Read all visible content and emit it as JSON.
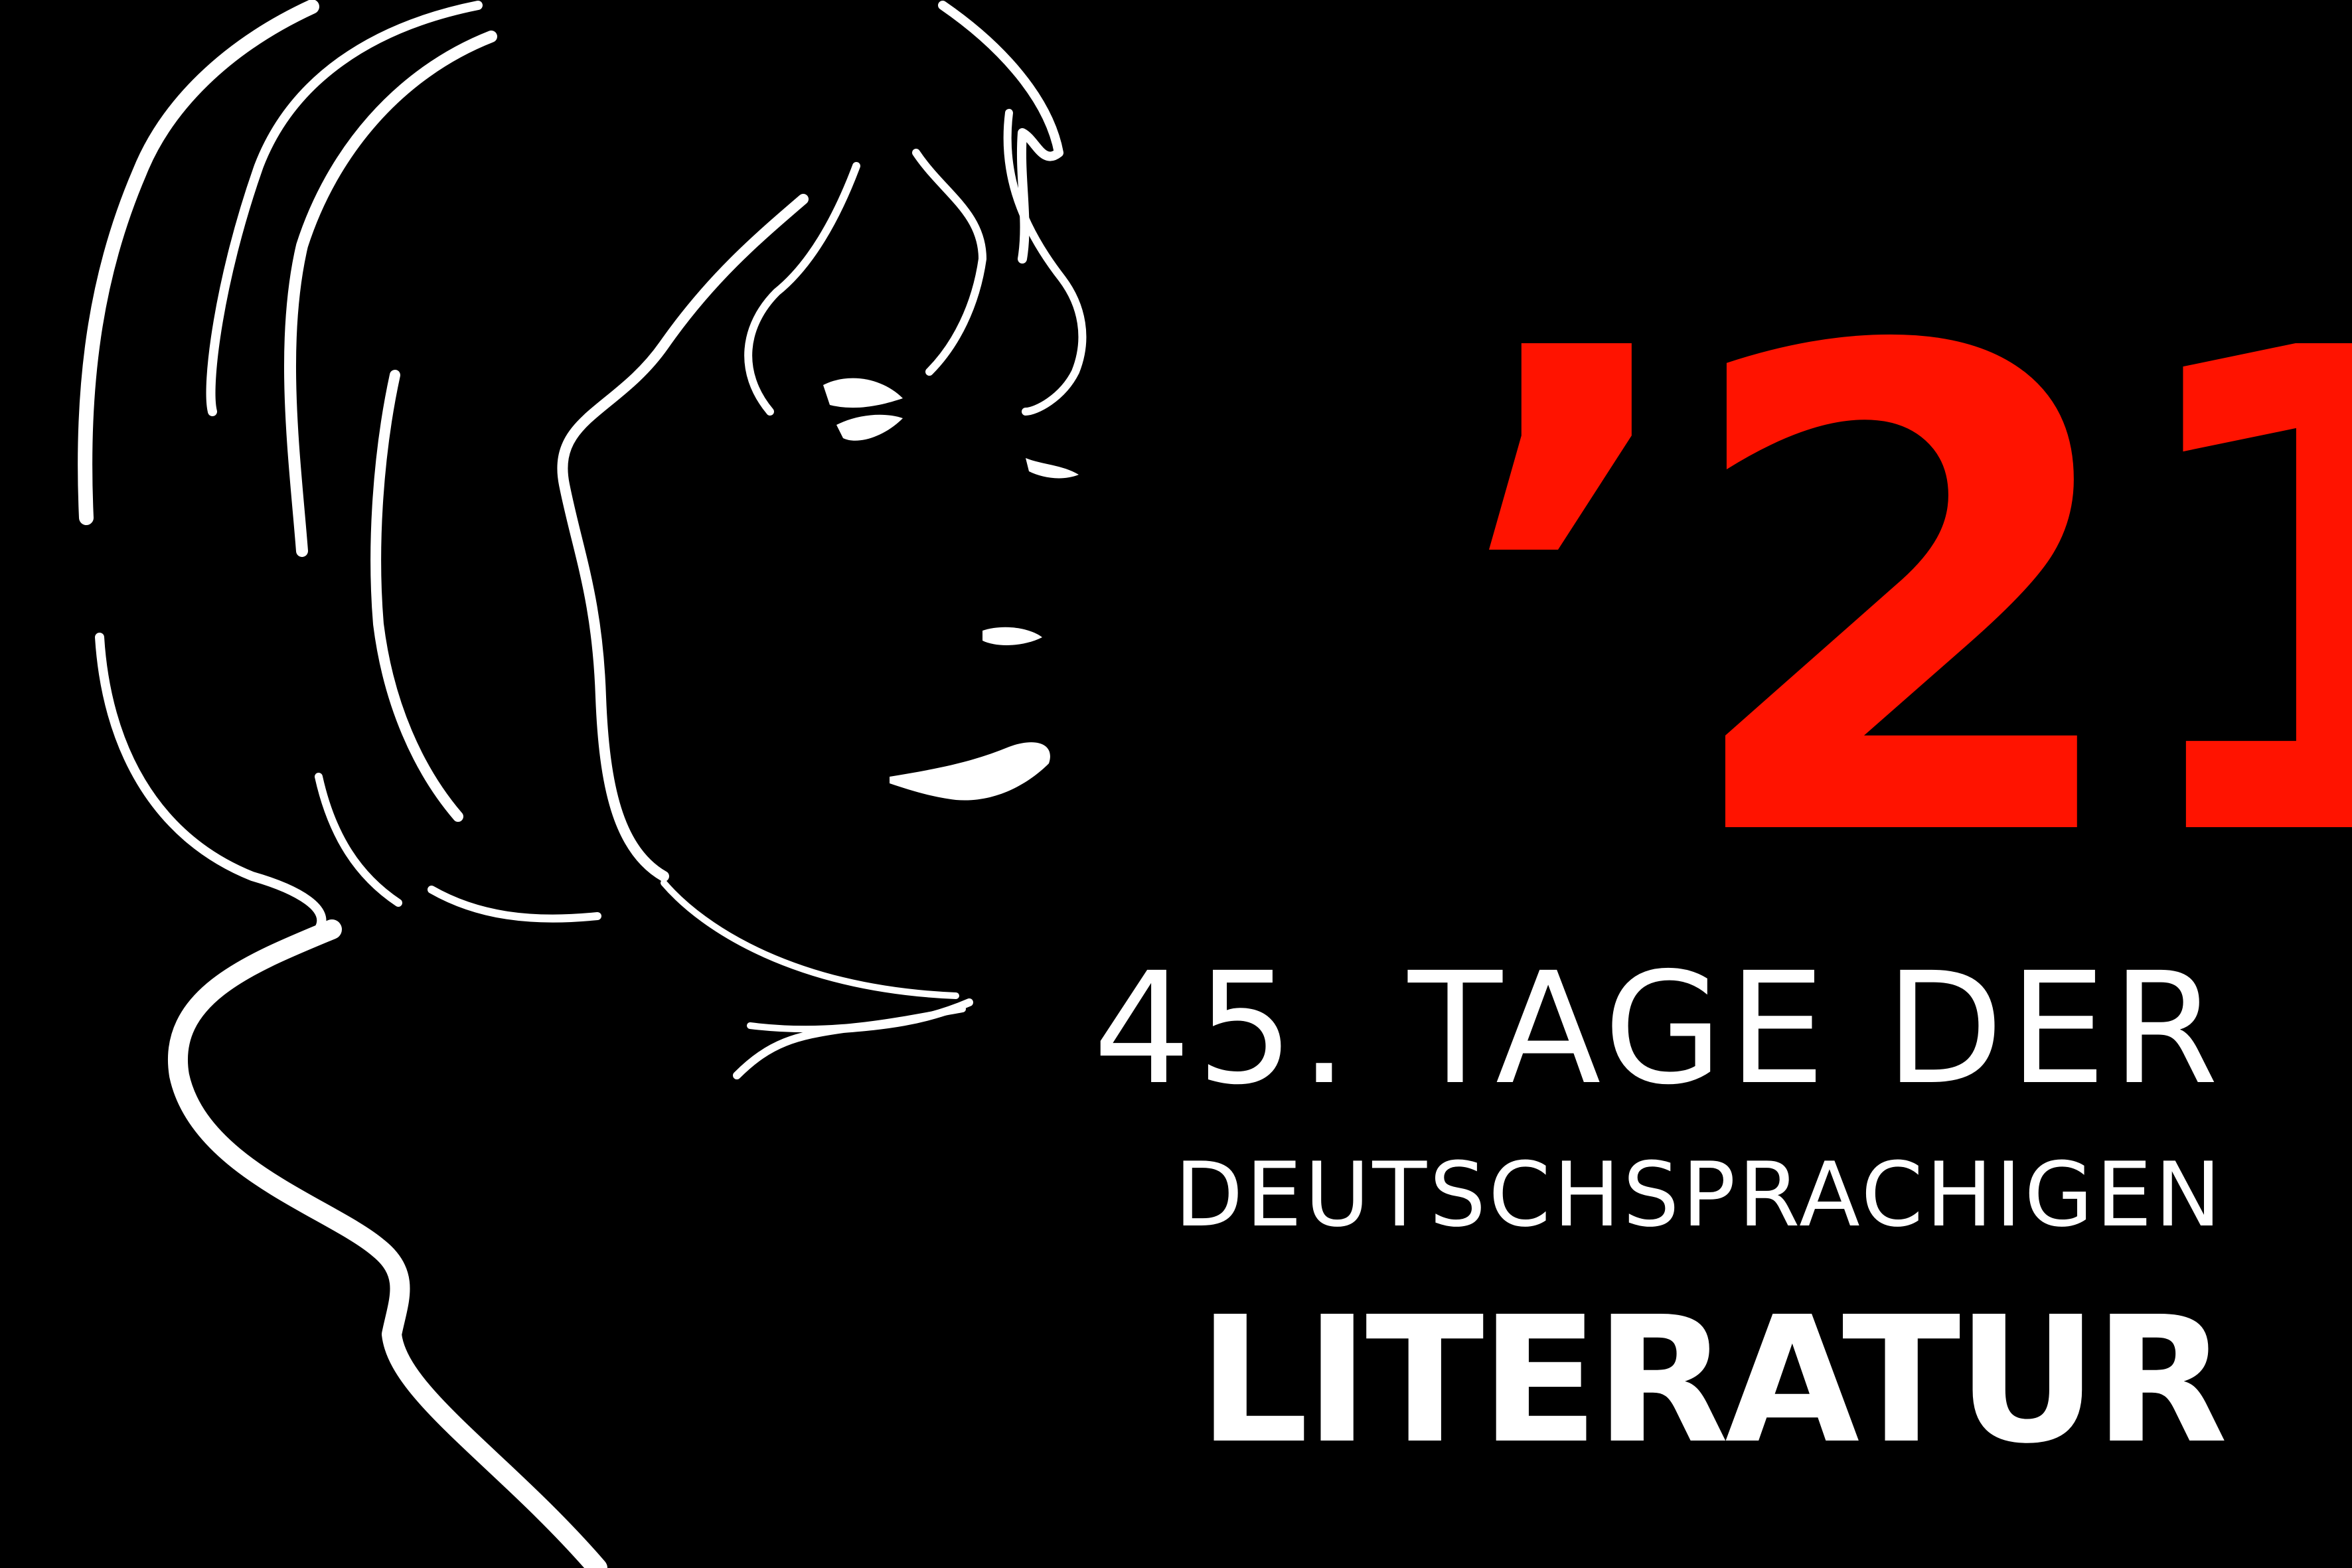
{
  "poster": {
    "year_label": "’21",
    "title_line_1": "45. TAGE DER",
    "title_line_2": "DEUTSCHSPRACHIGEN",
    "title_line_3": "LITERATUR"
  },
  "colors": {
    "background": "#000000",
    "accent": "#ff1300",
    "text": "#ffffff",
    "illustration": "#ffffff"
  },
  "icons": {
    "illustration": "woman-profile-line-art"
  }
}
